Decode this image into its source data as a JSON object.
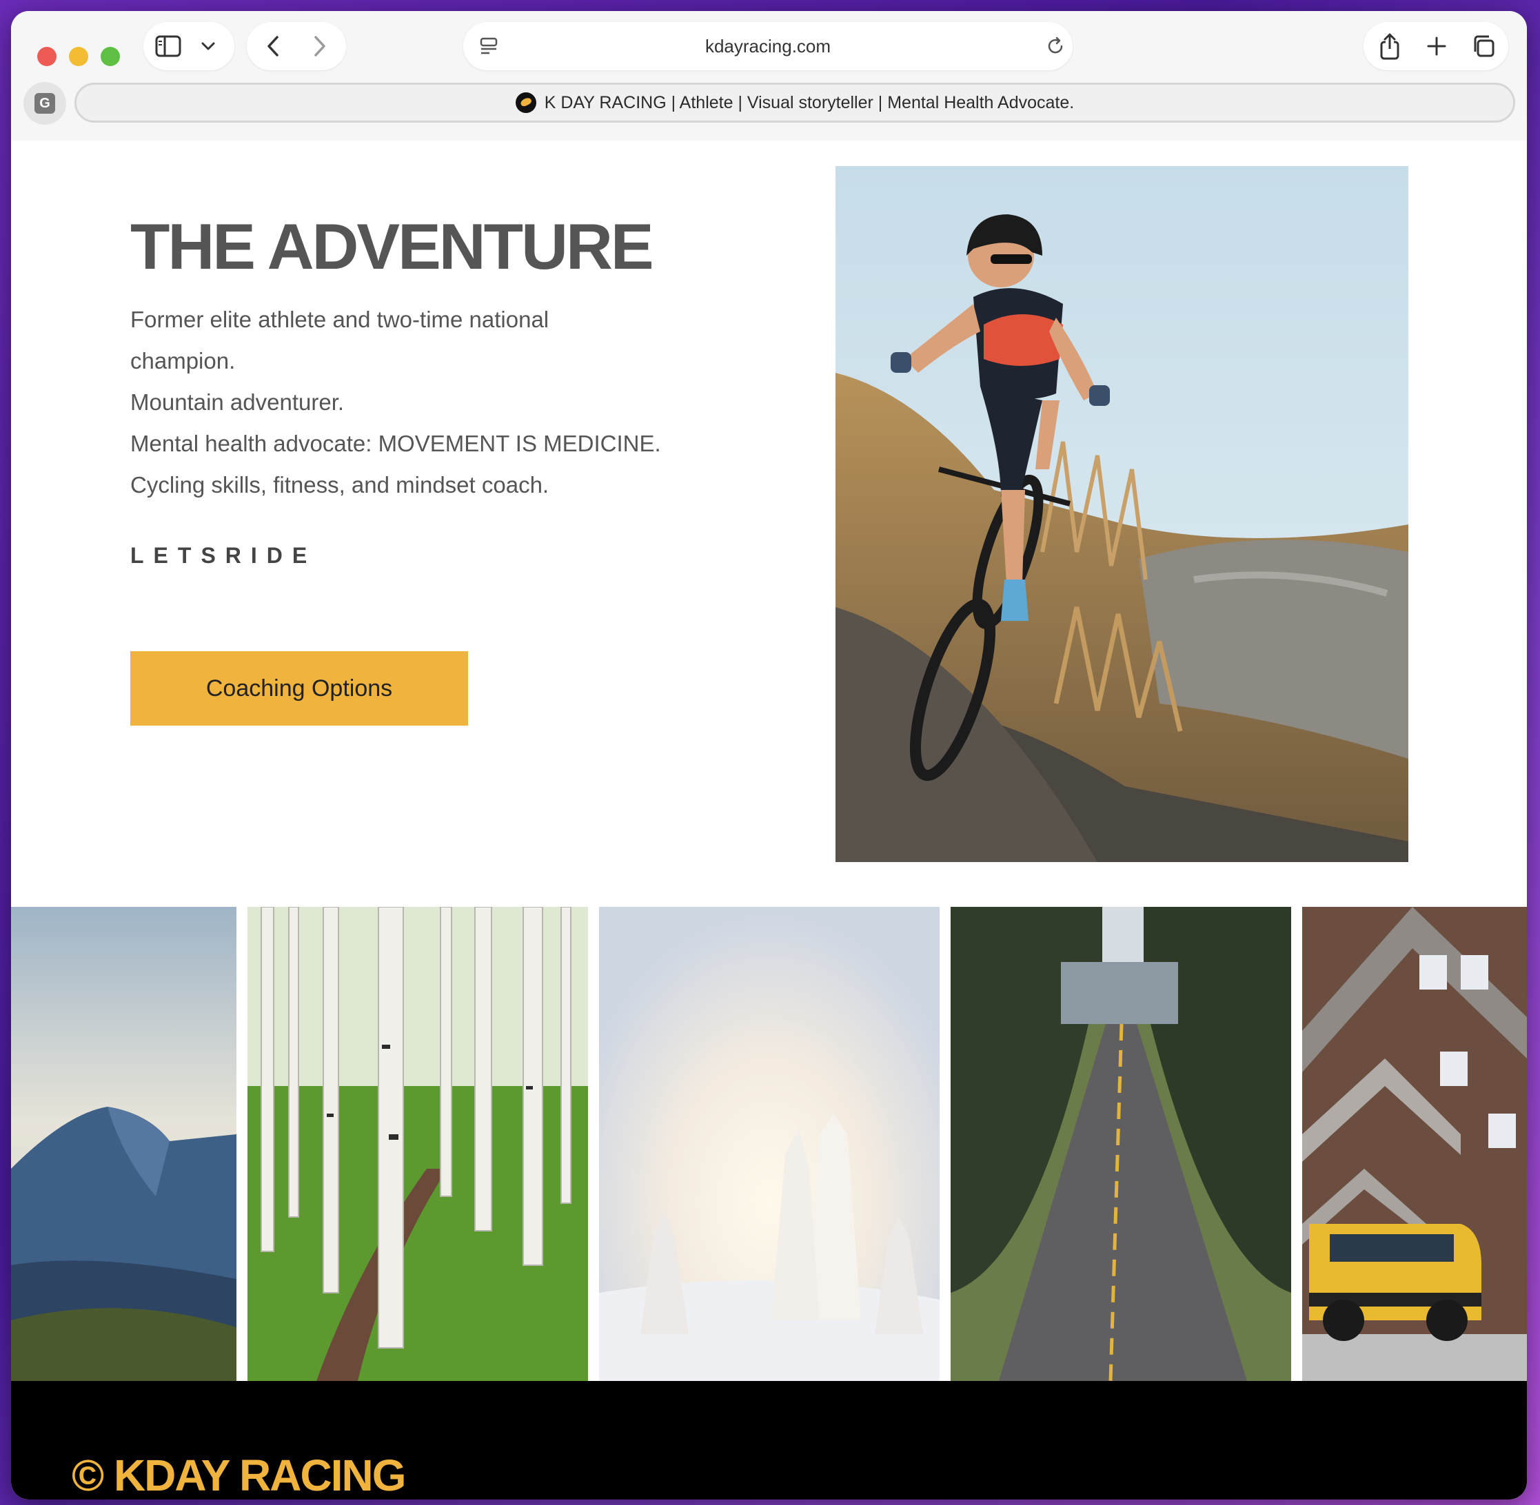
{
  "browser": {
    "url": "kdayracing.com",
    "tab_title": "K DAY RACING | Athlete | Visual storyteller | Mental Health Advocate.",
    "profile_letter": "G"
  },
  "hero": {
    "title": "THE ADVENTURE",
    "bio_lines": [
      "Former elite athlete and two-time national",
      "champion.",
      "Mountain adventurer.",
      "Mental health advocate: MOVEMENT IS MEDICINE.",
      "Cycling skills, fitness, and mindset coach."
    ],
    "tagline": "LETSRIDE",
    "cta_label": "Coaching Options"
  },
  "footer": {
    "copyright": "© KDAY RACING"
  },
  "colors": {
    "accent": "#f0b33e",
    "heading": "#555555",
    "footer_bg": "#000000"
  }
}
